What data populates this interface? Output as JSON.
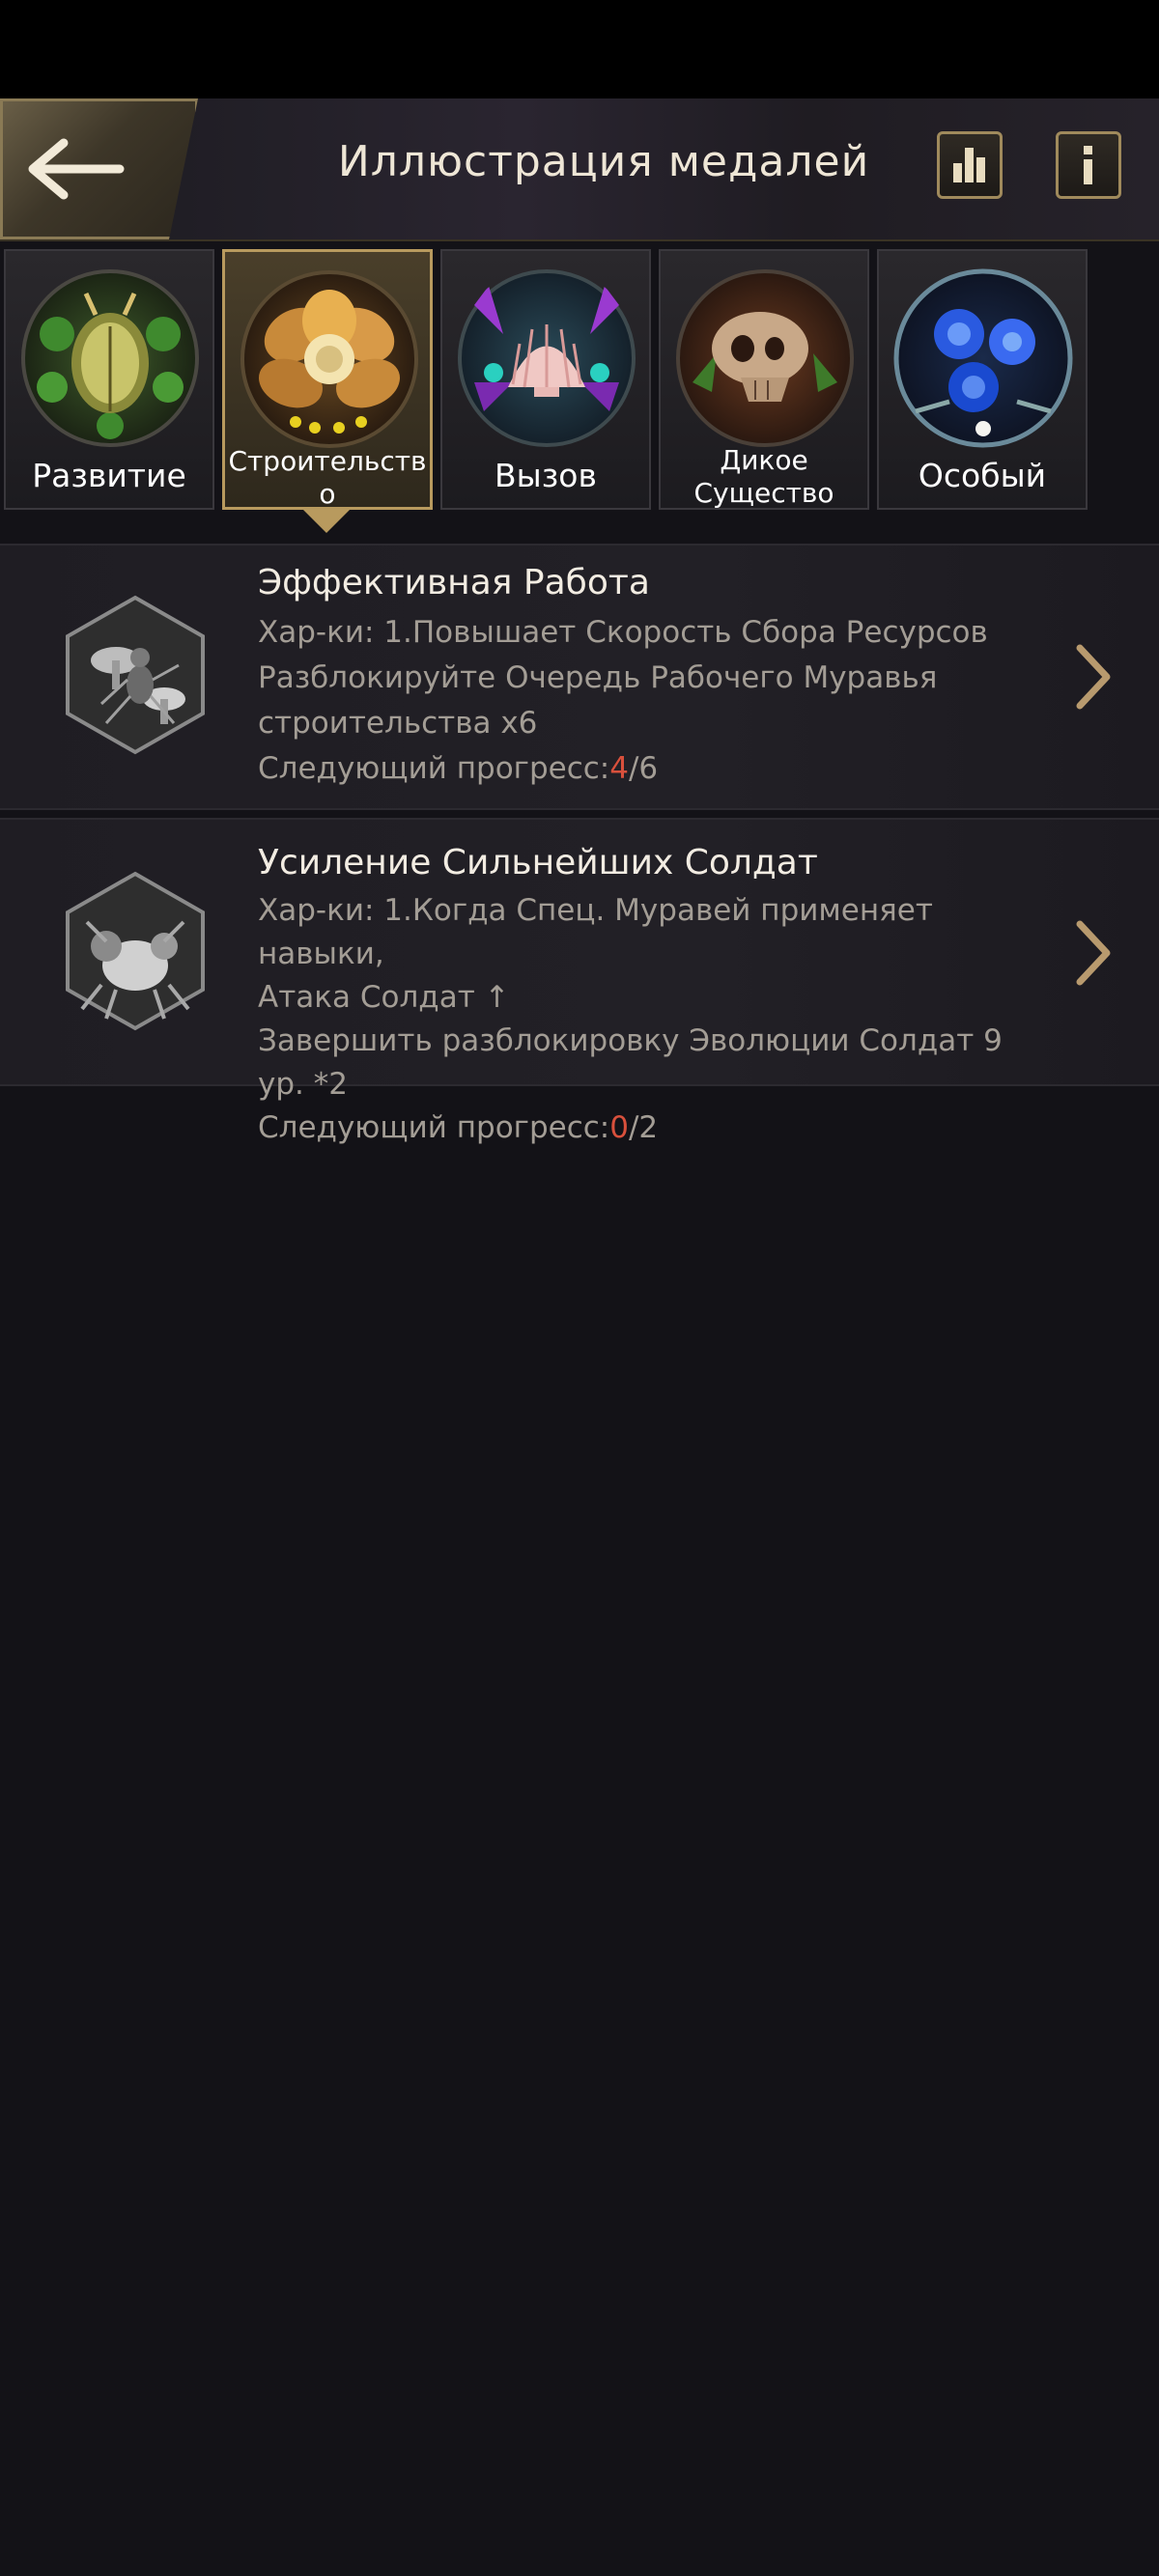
{
  "header": {
    "title": "Иллюстрация медалей"
  },
  "tabs": [
    {
      "label": "Развитие",
      "active": false,
      "icon": "beetle-clover-emblem"
    },
    {
      "label": "Строительство",
      "label_lines": [
        "Строительств",
        "о"
      ],
      "active": true,
      "icon": "golden-flower-emblem"
    },
    {
      "label": "Вызов",
      "active": false,
      "icon": "seashell-emblem"
    },
    {
      "label": "Дикое Существо",
      "label_lines": [
        "Дикое",
        "Существо"
      ],
      "active": false,
      "icon": "skull-emblem"
    },
    {
      "label": "Особый",
      "active": false,
      "icon": "blue-rose-emblem"
    }
  ],
  "cards": [
    {
      "title": "Эффективная Работа",
      "lines": [
        "Хар-ки: 1.Повышает Скорость Сбора Ресурсов",
        "Разблокируйте Очередь Рабочего Муравья",
        "строительства х6"
      ],
      "progress_label": "Следующий прогресс:",
      "progress_current": "4",
      "progress_total": "/6",
      "icon": "ant-mushroom-medal"
    },
    {
      "title": "Усиление Сильнейших Солдат",
      "lines": [
        "Хар-ки: 1.Когда Спец. Муравей применяет навыки,",
        "Атака Солдат ↑",
        "Завершить разблокировку Эволюции Солдат 9 ур. *2"
      ],
      "progress_label": "Следующий прогресс:",
      "progress_current": "0",
      "progress_total": "/2",
      "icon": "soldier-ant-medal"
    }
  ],
  "colors": {
    "accent_gold": "#b89a5e",
    "progress_current": "#d8503c",
    "background": "#131217"
  }
}
